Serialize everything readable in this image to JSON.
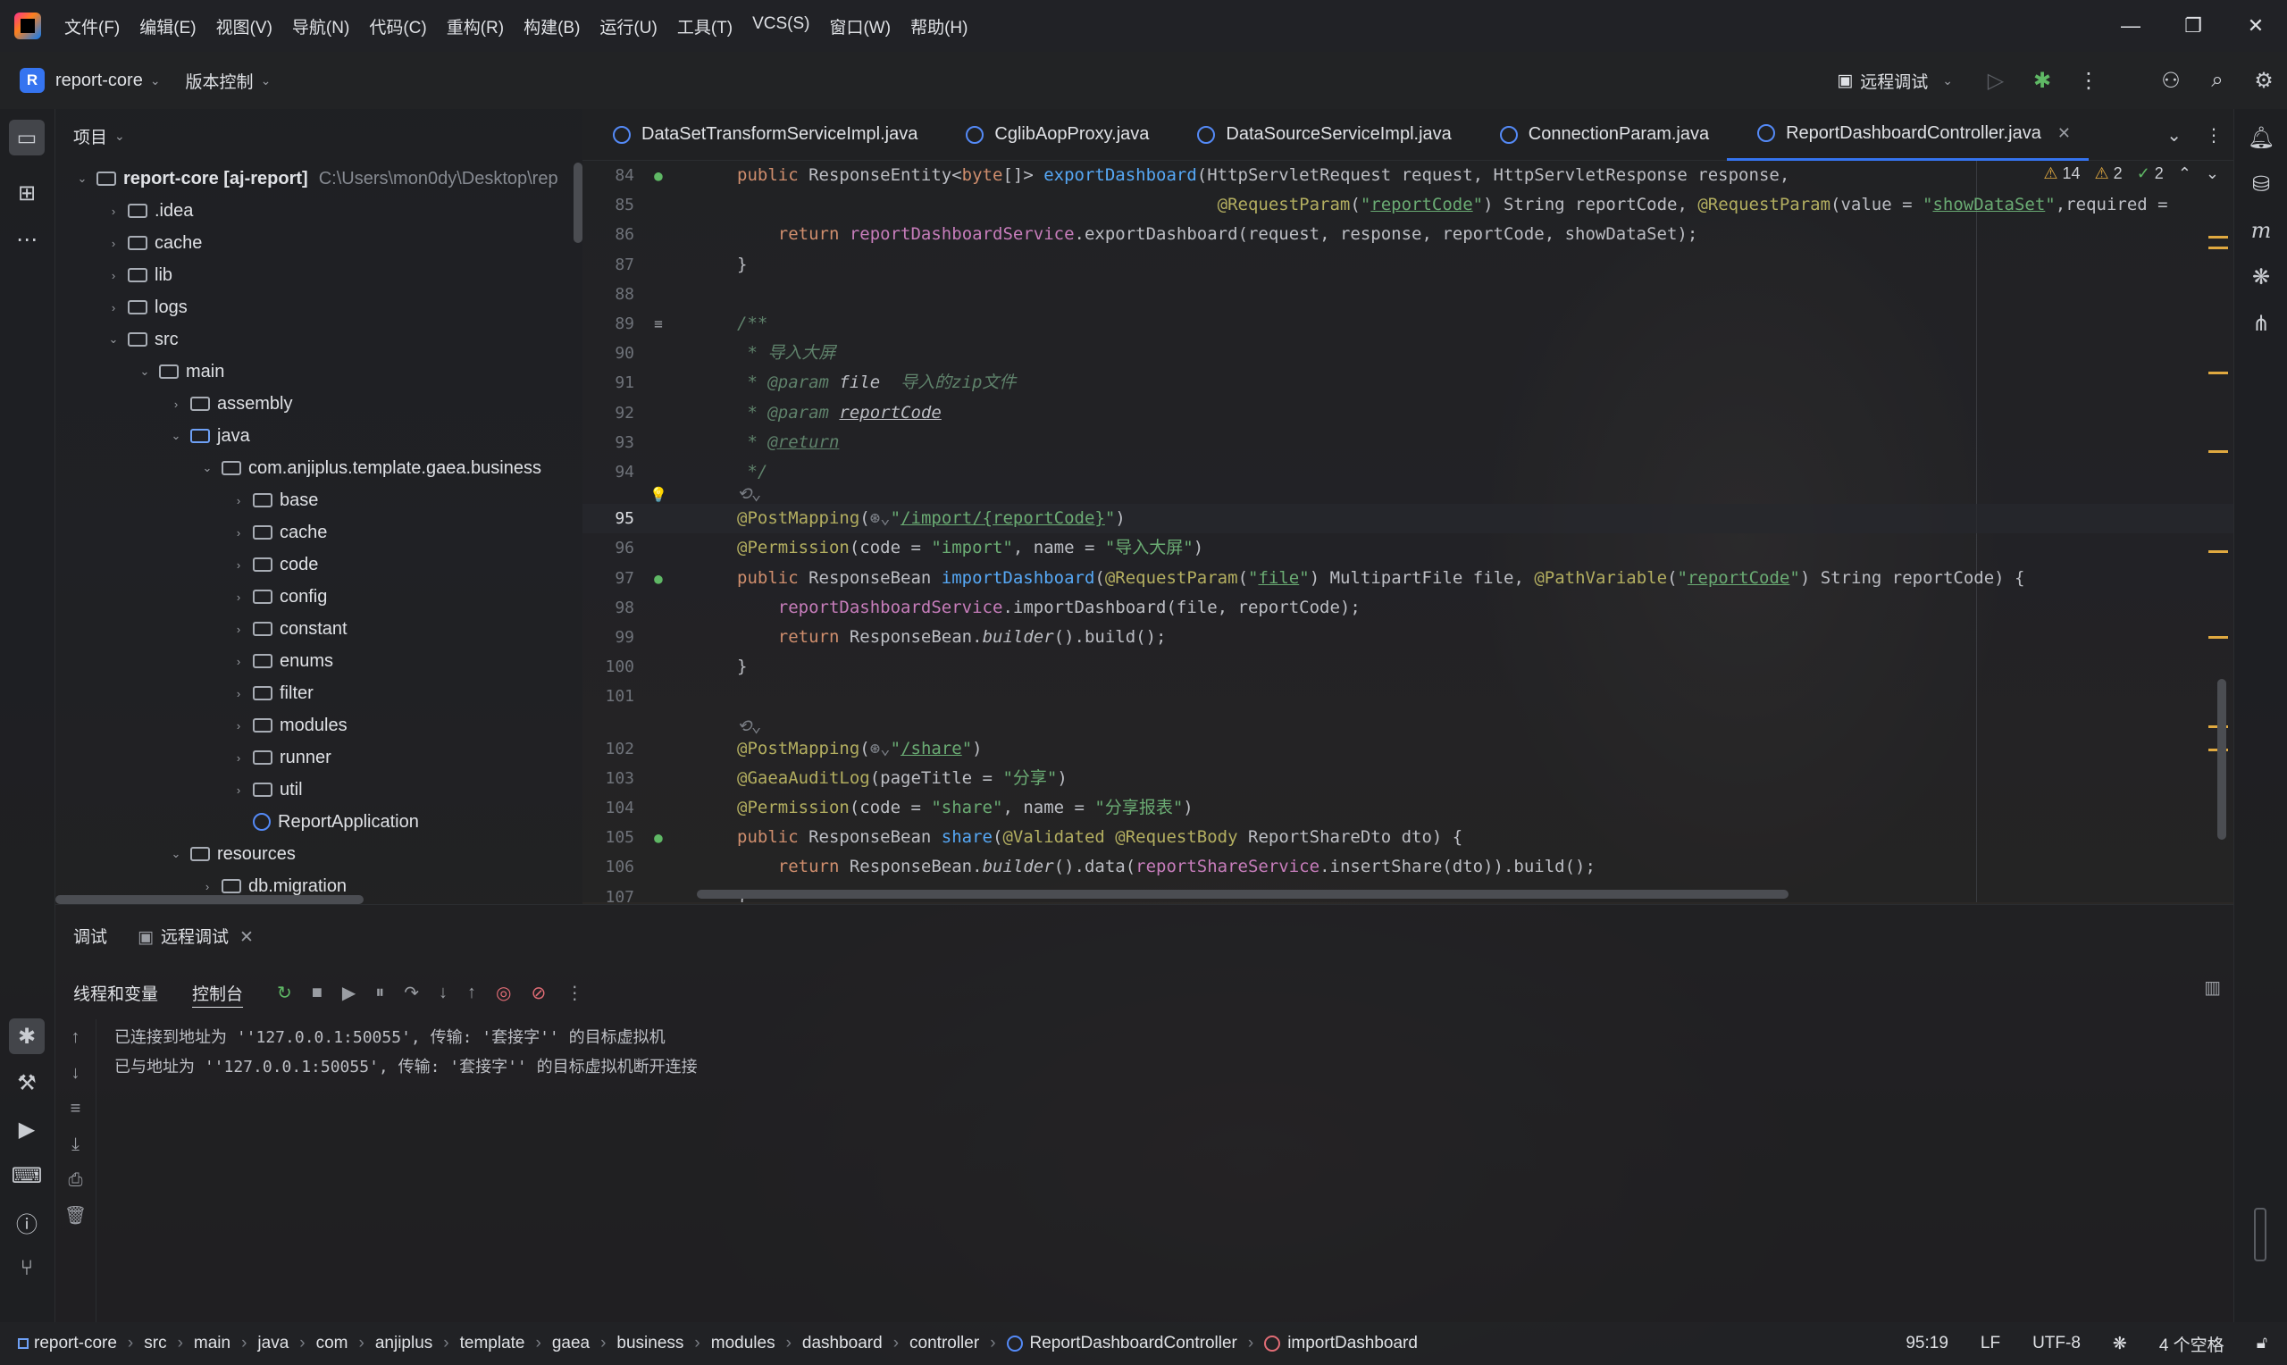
{
  "menu": [
    "文件(F)",
    "编辑(E)",
    "视图(V)",
    "导航(N)",
    "代码(C)",
    "重构(R)",
    "构建(B)",
    "运行(U)",
    "工具(T)",
    "VCS(S)",
    "窗口(W)",
    "帮助(H)"
  ],
  "toolbar": {
    "project_badge": "R",
    "project_name": "report-core",
    "vcs_label": "版本控制",
    "run_config": "远程调试"
  },
  "project_panel": {
    "title": "项目",
    "tree": [
      {
        "label": "report-core [aj-report]",
        "path": "C:\\Users\\mon0dy\\Desktop\\rep",
        "depth": 0,
        "expanded": true,
        "kind": "module"
      },
      {
        "label": ".idea",
        "depth": 1,
        "expanded": false,
        "kind": "folder"
      },
      {
        "label": "cache",
        "depth": 1,
        "expanded": false,
        "kind": "folder"
      },
      {
        "label": "lib",
        "depth": 1,
        "expanded": false,
        "kind": "folder"
      },
      {
        "label": "logs",
        "depth": 1,
        "expanded": false,
        "kind": "folder"
      },
      {
        "label": "src",
        "depth": 1,
        "expanded": true,
        "kind": "folder"
      },
      {
        "label": "main",
        "depth": 2,
        "expanded": true,
        "kind": "folder"
      },
      {
        "label": "assembly",
        "depth": 3,
        "expanded": false,
        "kind": "folder"
      },
      {
        "label": "java",
        "depth": 3,
        "expanded": true,
        "kind": "folder-blue"
      },
      {
        "label": "com.anjiplus.template.gaea.business",
        "depth": 4,
        "expanded": true,
        "kind": "package"
      },
      {
        "label": "base",
        "depth": 5,
        "expanded": false,
        "kind": "package"
      },
      {
        "label": "cache",
        "depth": 5,
        "expanded": false,
        "kind": "package"
      },
      {
        "label": "code",
        "depth": 5,
        "expanded": false,
        "kind": "package"
      },
      {
        "label": "config",
        "depth": 5,
        "expanded": false,
        "kind": "package"
      },
      {
        "label": "constant",
        "depth": 5,
        "expanded": false,
        "kind": "package"
      },
      {
        "label": "enums",
        "depth": 5,
        "expanded": false,
        "kind": "package"
      },
      {
        "label": "filter",
        "depth": 5,
        "expanded": false,
        "kind": "package"
      },
      {
        "label": "modules",
        "depth": 5,
        "expanded": false,
        "kind": "package"
      },
      {
        "label": "runner",
        "depth": 5,
        "expanded": false,
        "kind": "package"
      },
      {
        "label": "util",
        "depth": 5,
        "expanded": false,
        "kind": "package"
      },
      {
        "label": "ReportApplication",
        "depth": 5,
        "expanded": null,
        "kind": "class"
      },
      {
        "label": "resources",
        "depth": 3,
        "expanded": true,
        "kind": "folder"
      },
      {
        "label": "db.migration",
        "depth": 4,
        "expanded": false,
        "kind": "package"
      }
    ]
  },
  "tabs": [
    {
      "label": "DataSetTransformServiceImpl.java",
      "active": false
    },
    {
      "label": "CglibAopProxy.java",
      "active": false
    },
    {
      "label": "DataSourceServiceImpl.java",
      "active": false
    },
    {
      "label": "ConnectionParam.java",
      "active": false
    },
    {
      "label": "ReportDashboardController.java",
      "active": true
    }
  ],
  "inspections": {
    "warnings": "14",
    "weak_warnings": "2",
    "ok": "2"
  },
  "editor": {
    "current_line": 95,
    "lines": [
      {
        "n": "84",
        "html": "<span class='k'>public</span> ResponseEntity&lt;<span class='k'>byte</span>[]&gt; <span class='m'>exportDashboard</span>(HttpServletRequest request, HttpServletResponse response,",
        "gutter": "●"
      },
      {
        "n": "85",
        "html": "                                               <span class='a'>@RequestParam</span>(<span class='s'>\"<span class='ul'>reportCode</span>\"</span>) String reportCode, <span class='a'>@RequestParam</span>(value = <span class='s'>\"<span class='ul'>showDataSet</span>\"</span>,required = "
      },
      {
        "n": "86",
        "html": "    <span class='k'>return</span> <span class='f'>reportDashboardService</span>.exportDashboard(request, response, reportCode, showDataSet);"
      },
      {
        "n": "87",
        "html": "}"
      },
      {
        "n": "88",
        "html": ""
      },
      {
        "n": "89",
        "html": "<span class='cd'>/**</span>",
        "gutter": "≡"
      },
      {
        "n": "90",
        "html": "<span class='cd'> * 导入大屏</span>"
      },
      {
        "n": "91",
        "html": "<span class='cd'> * <span class='it'>@param</span> </span><span class='c' style='color:#bcbec4'>file</span><span class='cd'>  导入的zip文件</span>"
      },
      {
        "n": "92",
        "html": "<span class='cd'> * <span class='it'>@param</span> </span><span class='c ul' style='color:#bcbec4'>reportCode</span>"
      },
      {
        "n": "93",
        "html": "<span class='cd'> * <span class='ul'>@return</span></span>"
      },
      {
        "n": "94",
        "html": "<span class='cd'> */</span>"
      },
      {
        "n": "",
        "html": "<span class='c'>⟲⌄</span>",
        "gutter": "💡"
      },
      {
        "n": "95",
        "html": "<span class='a'>@PostMapping</span>(<span class='c'>⊛⌄</span><span class='s'>\"<span class='ul'>/import/{reportCode}</span>\"</span>)"
      },
      {
        "n": "96",
        "html": "<span class='a'>@Permission</span>(code = <span class='s'>\"import\"</span>, name = <span class='s'>\"导入大屏\"</span>)"
      },
      {
        "n": "97",
        "html": "<span class='k'>public</span> ResponseBean <span class='m'>importDashboard</span>(<span class='a'>@RequestParam</span>(<span class='s'>\"<span class='ul'>file</span>\"</span>) MultipartFile file, <span class='a'>@PathVariable</span>(<span class='s'>\"<span class='ul'>reportCode</span>\"</span>) String reportCode) {",
        "gutter": "●"
      },
      {
        "n": "98",
        "html": "    <span class='f'>reportDashboardService</span>.importDashboard(file, reportCode);"
      },
      {
        "n": "99",
        "html": "    <span class='k'>return</span> ResponseBean.<span class='it'>builder</span>().build();"
      },
      {
        "n": "100",
        "html": "}"
      },
      {
        "n": "101",
        "html": ""
      },
      {
        "n": "",
        "html": "<span class='c'>⟲⌄</span>"
      },
      {
        "n": "102",
        "html": "<span class='a'>@PostMapping</span>(<span class='c'>⊛⌄</span><span class='s'>\"<span class='ul'>/share</span>\"</span>)"
      },
      {
        "n": "103",
        "html": "<span class='a'>@GaeaAuditLog</span>(pageTitle = <span class='s'>\"分享\"</span>)"
      },
      {
        "n": "104",
        "html": "<span class='a'>@Permission</span>(code = <span class='s'>\"share\"</span>, name = <span class='s'>\"分享报表\"</span>)"
      },
      {
        "n": "105",
        "html": "<span class='k'>public</span> ResponseBean <span class='m'>share</span>(<span class='a'>@Validated</span> <span class='a'>@RequestBody</span> ReportShareDto dto) {",
        "gutter": "●"
      },
      {
        "n": "106",
        "html": "    <span class='k'>return</span> ResponseBean.<span class='it'>builder</span>().data(<span class='f'>reportShareService</span>.insertShare(dto)).build();"
      },
      {
        "n": "107",
        "html": "}"
      }
    ]
  },
  "debug": {
    "tab_debug": "调试",
    "tab_remote": "远程调试",
    "sub_threads": "线程和变量",
    "sub_console": "控制台",
    "console_lines": [
      "已连接到地址为 ''127.0.0.1:50055', 传输: '套接字'' 的目标虚拟机",
      "已与地址为 ''127.0.0.1:50055', 传输: '套接字'' 的目标虚拟机断开连接"
    ]
  },
  "status": {
    "breadcrumbs": [
      "report-core",
      "src",
      "main",
      "java",
      "com",
      "anjiplus",
      "template",
      "gaea",
      "business",
      "modules",
      "dashboard",
      "controller",
      "ReportDashboardController",
      "importDashboard"
    ],
    "position": "95:19",
    "line_sep": "LF",
    "encoding": "UTF-8",
    "indent": "4 个空格"
  },
  "colors": {
    "accent": "#3574f0",
    "annotation": "#b3ae60",
    "string": "#6aab73",
    "keyword": "#cf8e6d",
    "method": "#56a8f5",
    "field": "#c77dbb"
  }
}
